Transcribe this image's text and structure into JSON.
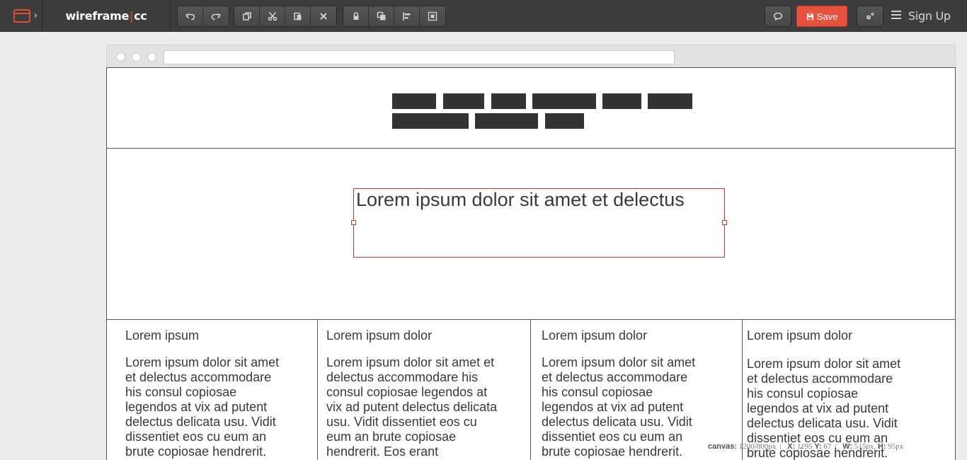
{
  "app": {
    "brand_left": "wireframe",
    "brand_sep": "|",
    "brand_right": "cc"
  },
  "toolbar": {
    "undo_icon": "undo-icon",
    "redo_icon": "redo-icon",
    "duplicate_icon": "duplicate-icon",
    "cut_icon": "scissors-icon",
    "paste_icon": "paste-icon",
    "delete_icon": "close-icon",
    "lock_icon": "lock-icon",
    "arrange_icon": "bring-to-front-icon",
    "align_icon": "align-left-icon",
    "group_icon": "group-icon"
  },
  "right_actions": {
    "comment_icon": "comment-icon",
    "save_label": "Save",
    "settings_icon": "gears-icon",
    "menu_icon": "hamburger-icon",
    "signup_label": "Sign Up"
  },
  "accent": "#e8513e",
  "hero": {
    "text": "Lorem ipsum dolor sit amet et delectus"
  },
  "columns": [
    {
      "heading": "Lorem ipsum",
      "body": "Lorem ipsum dolor sit amet et delectus accommodare his consul copiosae legendos at vix ad putent delectus delicata usu. Vidit dissentiet eos cu eum an brute copiosae hendrerit."
    },
    {
      "heading": "Lorem ipsum dolor",
      "body": "Lorem ipsum dolor sit amet et delectus accommodare his consul copiosae legendos at vix ad putent delectus delicata usu. Vidit dissentiet eos cu eum an brute copiosae hendrerit. Eos erant"
    },
    {
      "heading": "Lorem ipsum dolor",
      "body": "Lorem ipsum dolor sit amet et delectus accommodare his consul copiosae legendos at vix ad putent delectus delicata usu. Vidit dissentiet eos cu eum an brute copiosae hendrerit."
    },
    {
      "heading": "Lorem ipsum dolor",
      "body": "Lorem ipsum dolor sit amet et delectus accommodare his consul copiosae legendos at vix ad putent delectus delicata usu. Vidit dissentiet eos cu eum an brute copiosae hendrerit."
    }
  ],
  "status": {
    "canvas_label": "canvas:",
    "canvas_value": "1200/800px",
    "x_label": "X:",
    "x_value": "1195",
    "y_label": "Y:",
    "y_value": "67",
    "w_label": "W:",
    "w_value": "515px,",
    "h_label": "H:",
    "h_value": "95px"
  }
}
